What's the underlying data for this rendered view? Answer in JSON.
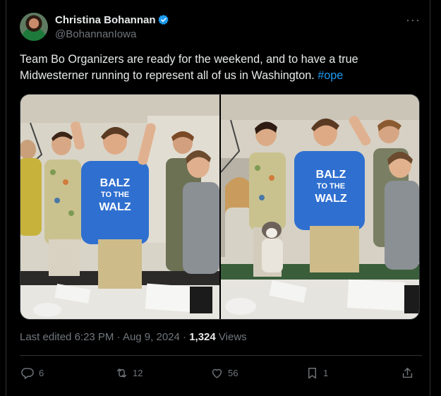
{
  "user": {
    "display_name": "Christina Bohannan",
    "handle": "@BohannanIowa",
    "verified": true
  },
  "tweet": {
    "text": "Team Bo Organizers are ready for the weekend, and to have a true Midwesterner running to represent all of us in Washington.",
    "hashtag": "#ope"
  },
  "photos": {
    "shirt_text_left": [
      "BALZ",
      "TO THE",
      "WALZ"
    ],
    "shirt_text_right": [
      "BALZ",
      "TO THE",
      "WALZ"
    ]
  },
  "meta": {
    "edited_prefix": "Last edited",
    "time": "6:23 PM",
    "separator": "·",
    "date": "Aug 9, 2024",
    "views_count": "1,324",
    "views_label": "Views"
  },
  "actions": {
    "replies": "6",
    "reposts": "12",
    "likes": "56",
    "bookmarks": "1"
  },
  "colors": {
    "background": "#000000",
    "text": "#e7e9ea",
    "muted": "#71767b",
    "link": "#1d9bf0",
    "shirt_blue": "#2f6fd0"
  },
  "icons": [
    "verified-badge-icon",
    "more-icon",
    "reply-icon",
    "repost-icon",
    "like-icon",
    "bookmark-icon",
    "share-icon"
  ]
}
